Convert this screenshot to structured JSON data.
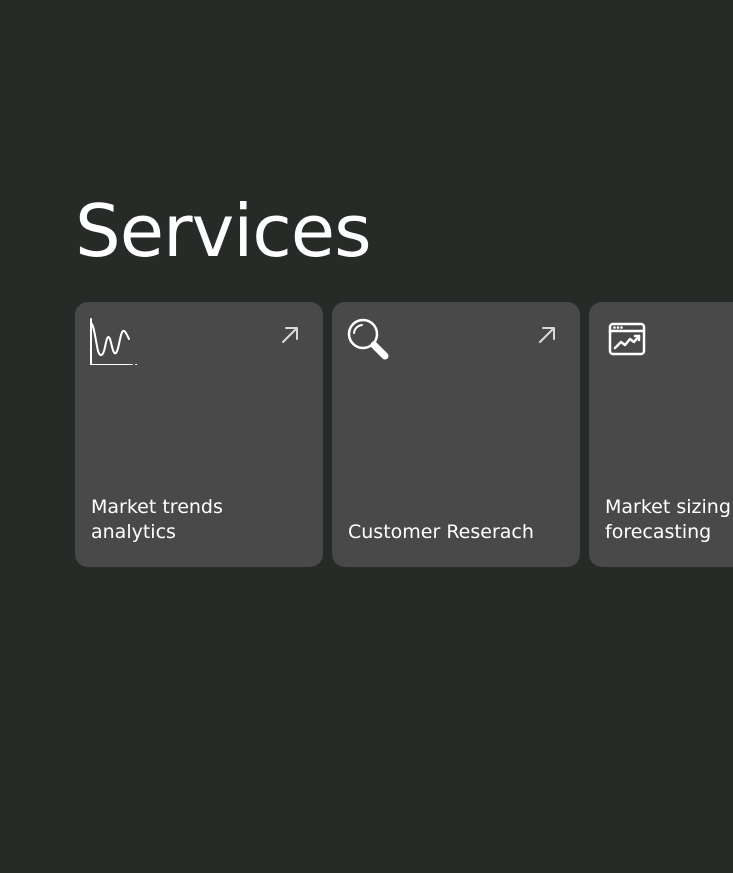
{
  "page": {
    "title": "Services"
  },
  "services": [
    {
      "label_line1": "Market trends",
      "label_line2": "analytics",
      "icon": "line-chart-icon",
      "link_icon": "arrow-up-right-icon"
    },
    {
      "label_line1": "Customer Reserach",
      "icon": "magnifier-icon",
      "link_icon": "arrow-up-right-icon"
    },
    {
      "label_line1": "Market sizing",
      "label_line2": "forecasting",
      "icon": "browser-chart-icon"
    }
  ],
  "colors": {
    "background": "#262b28",
    "card": "#494949",
    "text": "#ffffff",
    "arrow": "#d9d9d9"
  }
}
